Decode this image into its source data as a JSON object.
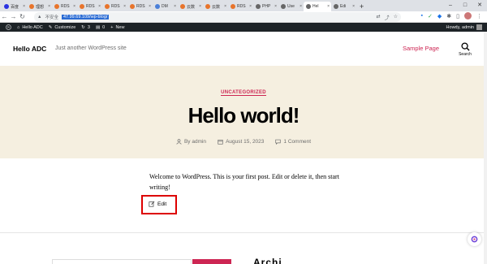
{
  "browser": {
    "tabs": [
      {
        "label": "百度",
        "color": "#2932e1"
      },
      {
        "label": "理想",
        "color": "#e8742b"
      },
      {
        "label": "RDS",
        "color": "#e8742b"
      },
      {
        "label": "RDS",
        "color": "#e8742b"
      },
      {
        "label": "RDS",
        "color": "#e8742b"
      },
      {
        "label": "RDS",
        "color": "#e8742b"
      },
      {
        "label": "DM",
        "color": "#4a7fd8"
      },
      {
        "label": "云数",
        "color": "#e8742b"
      },
      {
        "label": "云数",
        "color": "#e8742b"
      },
      {
        "label": "RDS",
        "color": "#e8742b"
      },
      {
        "label": "PHP",
        "color": "#666666"
      },
      {
        "label": "Use",
        "color": "#666666"
      },
      {
        "label": "Hel",
        "color": "#666666",
        "active": true
      },
      {
        "label": "Edi",
        "color": "#666666"
      }
    ],
    "new_tab": "+",
    "insecure_label": "不安全",
    "url": "47.99.69.109/wp-blog/"
  },
  "adminbar": {
    "site_name": "Hello ADC",
    "customize": "Customize",
    "updates_count": "3",
    "comments_count": "0",
    "new_label": "New",
    "howdy": "Howdy, admin"
  },
  "site": {
    "title": "Hello ADC",
    "description": "Just another WordPress site",
    "nav_link": "Sample Page",
    "search_label": "Search"
  },
  "post": {
    "category": "UNCATEGORIZED",
    "title": "Hello world!",
    "author": "By admin",
    "date": "August 15, 2023",
    "comments": "1 Comment",
    "body": "Welcome to WordPress. This is your first post. Edit or delete it, then start writing!",
    "edit_label": "Edit"
  },
  "colors": {
    "accent": "#cd2653",
    "hero_bg": "#f5efe0",
    "adminbar_bg": "#1d2327",
    "highlight_box": "#dd0000"
  },
  "footer_heading": "Archi"
}
